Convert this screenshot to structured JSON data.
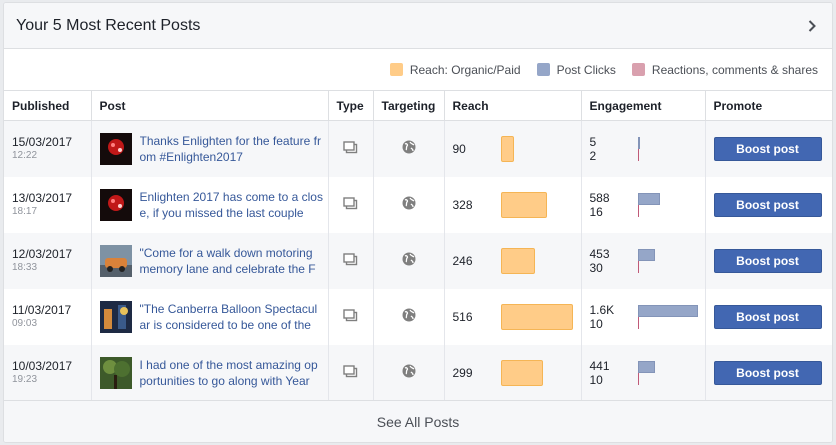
{
  "header": {
    "title": "Your 5 Most Recent Posts"
  },
  "legend": [
    {
      "label": "Reach: Organic/Paid",
      "color": "#ffcc88"
    },
    {
      "label": "Post Clicks",
      "color": "#95a6c8"
    },
    {
      "label": "Reactions, comments & shares",
      "color": "#d9a0ae"
    }
  ],
  "columns": [
    "Published",
    "Post",
    "Type",
    "Targeting",
    "Reach",
    "Engagement",
    "Promote"
  ],
  "max_reach": 516,
  "max_clicks": 1600,
  "posts": [
    {
      "date": "15/03/2017",
      "time": "12:22",
      "text": "Thanks Enlighten for the feature from #Enlighten2017",
      "thumb": "red-light-photo",
      "type_icon": "status-icon",
      "targeting_icon": "globe-icon",
      "reach": "90",
      "reach_value": 90,
      "clicks": "5",
      "clicks_value": 5,
      "reactions": "2",
      "reactions_value": 2,
      "promote": "Boost post"
    },
    {
      "date": "13/03/2017",
      "time": "18:17",
      "text": "Enlighten 2017 has come to a close, if you missed the last couple",
      "thumb": "red-light-photo",
      "type_icon": "status-icon",
      "targeting_icon": "globe-icon",
      "reach": "328",
      "reach_value": 328,
      "clicks": "588",
      "clicks_value": 588,
      "reactions": "16",
      "reactions_value": 16,
      "promote": "Boost post"
    },
    {
      "date": "12/03/2017",
      "time": "18:33",
      "text": "\"Come for a walk down motoring memory lane and celebrate the F",
      "thumb": "car-photo",
      "type_icon": "status-icon",
      "targeting_icon": "globe-icon",
      "reach": "246",
      "reach_value": 246,
      "clicks": "453",
      "clicks_value": 453,
      "reactions": "30",
      "reactions_value": 30,
      "promote": "Boost post"
    },
    {
      "date": "11/03/2017",
      "time": "09:03",
      "text": "\"The Canberra Balloon Spectacular is considered to be one of the",
      "thumb": "balloon-photo",
      "type_icon": "status-icon",
      "targeting_icon": "globe-icon",
      "reach": "516",
      "reach_value": 516,
      "clicks": "1.6K",
      "clicks_value": 1600,
      "reactions": "10",
      "reactions_value": 10,
      "promote": "Boost post"
    },
    {
      "date": "10/03/2017",
      "time": "19:23",
      "text": "I had one of the most amazing opportunities to go along with Year",
      "thumb": "tree-photo",
      "type_icon": "status-icon",
      "targeting_icon": "globe-icon",
      "reach": "299",
      "reach_value": 299,
      "clicks": "441",
      "clicks_value": 441,
      "reactions": "10",
      "reactions_value": 10,
      "promote": "Boost post"
    }
  ],
  "footer": {
    "label": "See All Posts"
  }
}
